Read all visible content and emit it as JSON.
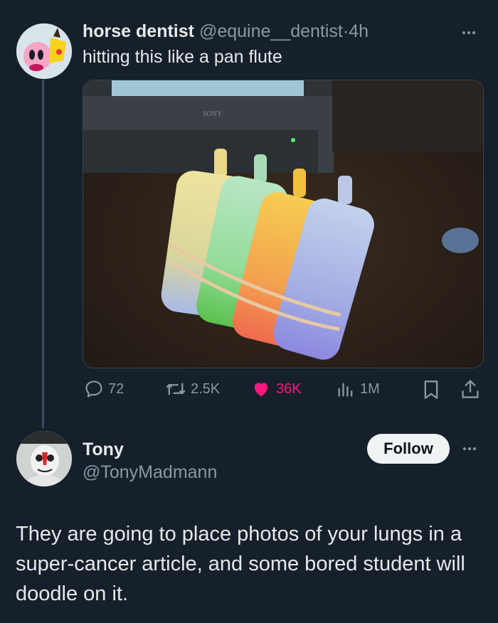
{
  "tweet": {
    "display_name": "horse dentist",
    "handle": "@equine__dentist",
    "separator": "·",
    "time": "4h",
    "text": "hitting this like a pan flute",
    "image_brand_text": "SONY",
    "stats": {
      "replies": "72",
      "retweets": "2.5K",
      "likes": "36K",
      "views": "1M"
    }
  },
  "reply": {
    "display_name": "Tony",
    "handle": "@TonyMadmann",
    "follow_label": "Follow",
    "text": "They are going to place photos of your lungs in a super-cancer article, and some bored student will doodle on it."
  },
  "colors": {
    "background": "#15202b",
    "text": "#e7e9ea",
    "muted": "#8b98a5",
    "like": "#f91880",
    "thread_line": "#3d4c5a"
  }
}
